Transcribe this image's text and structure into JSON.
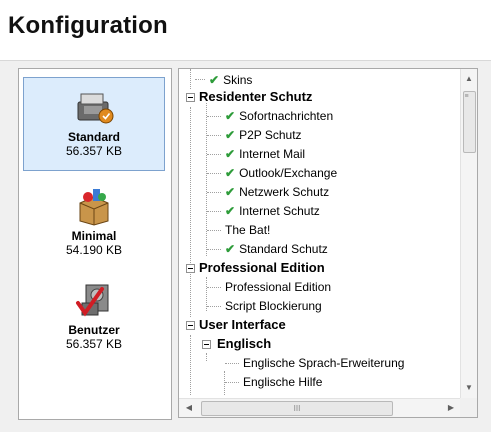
{
  "header": {
    "title": "Konfiguration"
  },
  "profiles": [
    {
      "name": "Standard",
      "size": "56.357 KB",
      "icon": "standard-profile-icon",
      "selected": true
    },
    {
      "name": "Minimal",
      "size": "54.190 KB",
      "icon": "minimal-profile-icon",
      "selected": false
    },
    {
      "name": "Benutzer",
      "size": "56.357 KB",
      "icon": "custom-profile-icon",
      "selected": false
    }
  ],
  "tree": {
    "nodes": [
      {
        "label": "Skins",
        "checked": true
      },
      {
        "label": "Residenter Schutz",
        "group": true
      },
      {
        "label": "Sofortnachrichten",
        "checked": true
      },
      {
        "label": "P2P Schutz",
        "checked": true
      },
      {
        "label": "Internet Mail",
        "checked": true
      },
      {
        "label": "Outlook/Exchange",
        "checked": true
      },
      {
        "label": "Netzwerk Schutz",
        "checked": true
      },
      {
        "label": "Internet Schutz",
        "checked": true
      },
      {
        "label": "The Bat!",
        "checked": false
      },
      {
        "label": "Standard Schutz",
        "checked": true
      },
      {
        "label": "Professional Edition",
        "group": true
      },
      {
        "label": "Professional Edition",
        "checked": false
      },
      {
        "label": "Script Blockierung",
        "checked": false
      },
      {
        "label": "User Interface",
        "group": true
      },
      {
        "label": "Englisch",
        "group": true
      },
      {
        "label": "Englische Sprach-Erweiterung",
        "checked": false
      },
      {
        "label": "Englische Hilfe",
        "checked": false
      }
    ],
    "check_glyph": "✔",
    "accent_check": "#2e9c3a",
    "selected_bg": "#dcecfc"
  },
  "scrollbars": {
    "up": "▲",
    "down": "▼",
    "left": "◀",
    "right": "▶",
    "grip": "≡",
    "hgrip": "III"
  }
}
